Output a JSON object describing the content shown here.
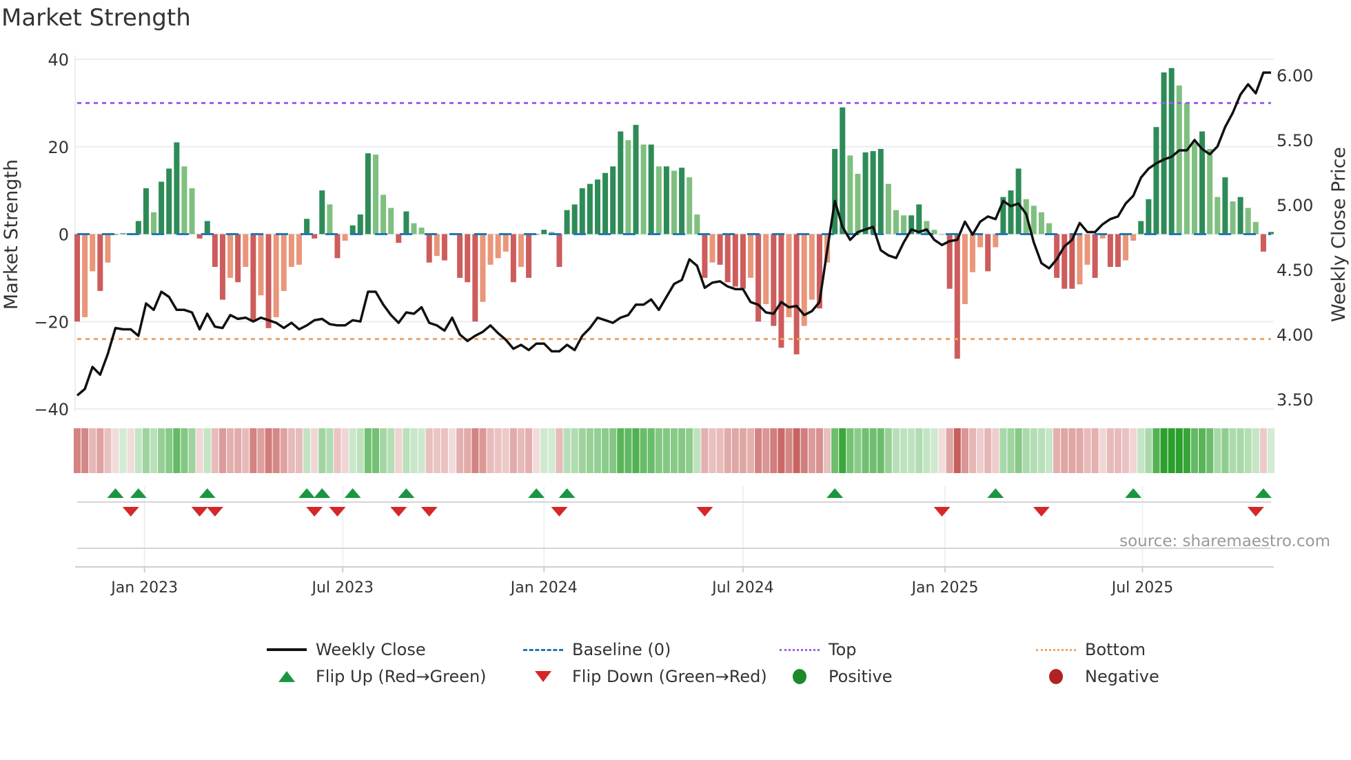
{
  "title": "Market Strength",
  "source": "source: sharemaestro.com",
  "colors": {
    "pos_rising": "#2e8b57",
    "pos_falling": "#7fbf7f",
    "neg_falling": "#cd5c5c",
    "neg_rising": "#e9967a",
    "close": "#111111",
    "baseline": "#1f77b4",
    "top": "#9b5de5",
    "bottom": "#f4a261",
    "flip_up": "#1a9641",
    "flip_down": "#d62728",
    "positive": "#1a8a2a",
    "negative": "#b22222"
  },
  "chart_data": {
    "type": "bar",
    "title": "Market Strength",
    "ylabel": "Market Strength",
    "y2label": "Weekly Close Price",
    "ylim": [
      -40,
      40
    ],
    "y2lim": [
      3.5,
      6.1
    ],
    "yticks": [
      "40",
      "20",
      "0",
      "−20",
      "−40"
    ],
    "ytick_values": [
      40,
      20,
      0,
      -20,
      -40
    ],
    "y2ticks": [
      "6.00",
      "5.50",
      "5.00",
      "4.50",
      "4.00",
      "3.50"
    ],
    "y2tick_values": [
      6.0,
      5.5,
      5.0,
      4.5,
      4.0,
      3.5
    ],
    "xticks": [
      {
        "label": "Jan 2023",
        "week": 8.8
      },
      {
        "label": "Jul 2023",
        "week": 34.7
      },
      {
        "label": "Jan 2024",
        "week": 61
      },
      {
        "label": "Jul 2024",
        "week": 87
      },
      {
        "label": "Jan 2025",
        "week": 113.4
      },
      {
        "label": "Jul 2025",
        "week": 139.2
      }
    ],
    "top_level": 30,
    "bottom_level": -24,
    "baseline": 0,
    "strength": [
      -20,
      -19,
      -8.5,
      -13,
      -6.5,
      0,
      0.2,
      0,
      3,
      10.5,
      5,
      12,
      15,
      21,
      15.5,
      10.5,
      -1,
      3,
      -7.5,
      -15,
      -10,
      -11,
      -7.5,
      -20,
      -14,
      -21.5,
      -19,
      -13,
      -7.5,
      -7,
      3.5,
      -1,
      10,
      6.8,
      -5.5,
      -1.5,
      2,
      4.5,
      18.5,
      18.2,
      9,
      6,
      -2,
      5.2,
      2.5,
      1.5,
      -6.5,
      -5,
      -6,
      0,
      -10,
      -11,
      -20,
      -15.5,
      -7,
      -5.5,
      -4,
      -11,
      -7.5,
      -10,
      0,
      1,
      0.5,
      -7.5,
      5.5,
      6.8,
      10.5,
      11.5,
      12.5,
      14,
      15.5,
      23.5,
      21.5,
      25,
      20.5,
      20.5,
      15.5,
      15.5,
      14.5,
      15.2,
      13,
      4.5,
      -10,
      -6.5,
      -7,
      -11,
      -12,
      -12.5,
      -10,
      -20,
      -16,
      -21,
      -26,
      -19,
      -27.5,
      -21,
      -15,
      -17,
      -6.5,
      19.5,
      29,
      18,
      13.8,
      18.7,
      19,
      19.5,
      11.5,
      5.5,
      4.3,
      4.3,
      6.8,
      3,
      1,
      0,
      -12.5,
      -28.5,
      -16,
      -8.7,
      -3,
      -8.5,
      -3,
      8.5,
      10,
      15,
      8,
      6.5,
      5,
      2.5,
      -10,
      -12.5,
      -12.5,
      -11.5,
      -7,
      -10,
      -1,
      -7.5,
      -7.5,
      -6,
      -1.5,
      3,
      8,
      24.5,
      37,
      38,
      34,
      30,
      21,
      23.5,
      19.5,
      8.5,
      13,
      7.5,
      8.5,
      6,
      2.8,
      -4,
      0.5
    ],
    "weekly_close": [
      3.53,
      3.58,
      3.75,
      3.69,
      3.85,
      4.05,
      4.04,
      4.04,
      3.99,
      4.24,
      4.19,
      4.33,
      4.29,
      4.19,
      4.19,
      4.17,
      4.04,
      4.16,
      4.06,
      4.05,
      4.15,
      4.12,
      4.13,
      4.1,
      4.13,
      4.11,
      4.09,
      4.05,
      4.09,
      4.04,
      4.07,
      4.11,
      4.12,
      4.08,
      4.07,
      4.07,
      4.11,
      4.1,
      4.33,
      4.33,
      4.23,
      4.15,
      4.09,
      4.17,
      4.16,
      4.21,
      4.09,
      4.07,
      4.03,
      4.13,
      4.0,
      3.95,
      3.99,
      4.02,
      4.07,
      4.01,
      3.96,
      3.89,
      3.92,
      3.88,
      3.93,
      3.93,
      3.87,
      3.87,
      3.92,
      3.88,
      3.99,
      4.05,
      4.13,
      4.11,
      4.09,
      4.13,
      4.15,
      4.23,
      4.23,
      4.27,
      4.19,
      4.29,
      4.39,
      4.42,
      4.58,
      4.53,
      4.36,
      4.4,
      4.41,
      4.37,
      4.35,
      4.35,
      4.25,
      4.23,
      4.17,
      4.16,
      4.25,
      4.21,
      4.22,
      4.15,
      4.18,
      4.25,
      4.65,
      5.03,
      4.83,
      4.73,
      4.79,
      4.81,
      4.83,
      4.65,
      4.61,
      4.59,
      4.71,
      4.81,
      4.79,
      4.81,
      4.73,
      4.69,
      4.72,
      4.73,
      4.87,
      4.77,
      4.87,
      4.91,
      4.89,
      5.03,
      4.99,
      5.01,
      4.93,
      4.71,
      4.55,
      4.51,
      4.58,
      4.68,
      4.73,
      4.86,
      4.79,
      4.79,
      4.85,
      4.89,
      4.91,
      5.01,
      5.07,
      5.21,
      5.28,
      5.32,
      5.35,
      5.37,
      5.42,
      5.42,
      5.5,
      5.43,
      5.39,
      5.45,
      5.6,
      5.71,
      5.85,
      5.93,
      5.86,
      6.02,
      6.02
    ],
    "flip_up_weeks": [
      5,
      8,
      17,
      30,
      32,
      36,
      43,
      60,
      64,
      99,
      120,
      138,
      155
    ],
    "flip_down_weeks": [
      7,
      16,
      18,
      31,
      34,
      42,
      46,
      63,
      82,
      113,
      126,
      154
    ],
    "legend_placement": "bottom"
  },
  "legend": {
    "weekly_close": "Weekly Close",
    "baseline": "Baseline (0)",
    "top": "Top",
    "bottom": "Bottom",
    "flip_up": "Flip Up (Red→Green)",
    "flip_down": "Flip Down (Green→Red)",
    "positive": "Positive",
    "negative": "Negative"
  }
}
